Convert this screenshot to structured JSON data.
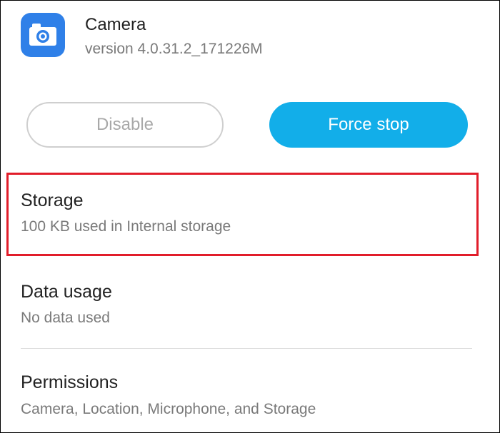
{
  "app": {
    "name": "Camera",
    "version": "version 4.0.31.2_171226M",
    "icon": "camera-app-icon"
  },
  "actions": {
    "disable_label": "Disable",
    "force_stop_label": "Force stop"
  },
  "items": {
    "storage": {
      "title": "Storage",
      "subtitle": "100 KB used in Internal storage"
    },
    "data_usage": {
      "title": "Data usage",
      "subtitle": "No data used"
    },
    "permissions": {
      "title": "Permissions",
      "subtitle": "Camera, Location, Microphone, and Storage"
    }
  },
  "colors": {
    "accent": "#12aee9",
    "highlight": "#e11d2a",
    "icon_blue": "#2f80e8"
  }
}
